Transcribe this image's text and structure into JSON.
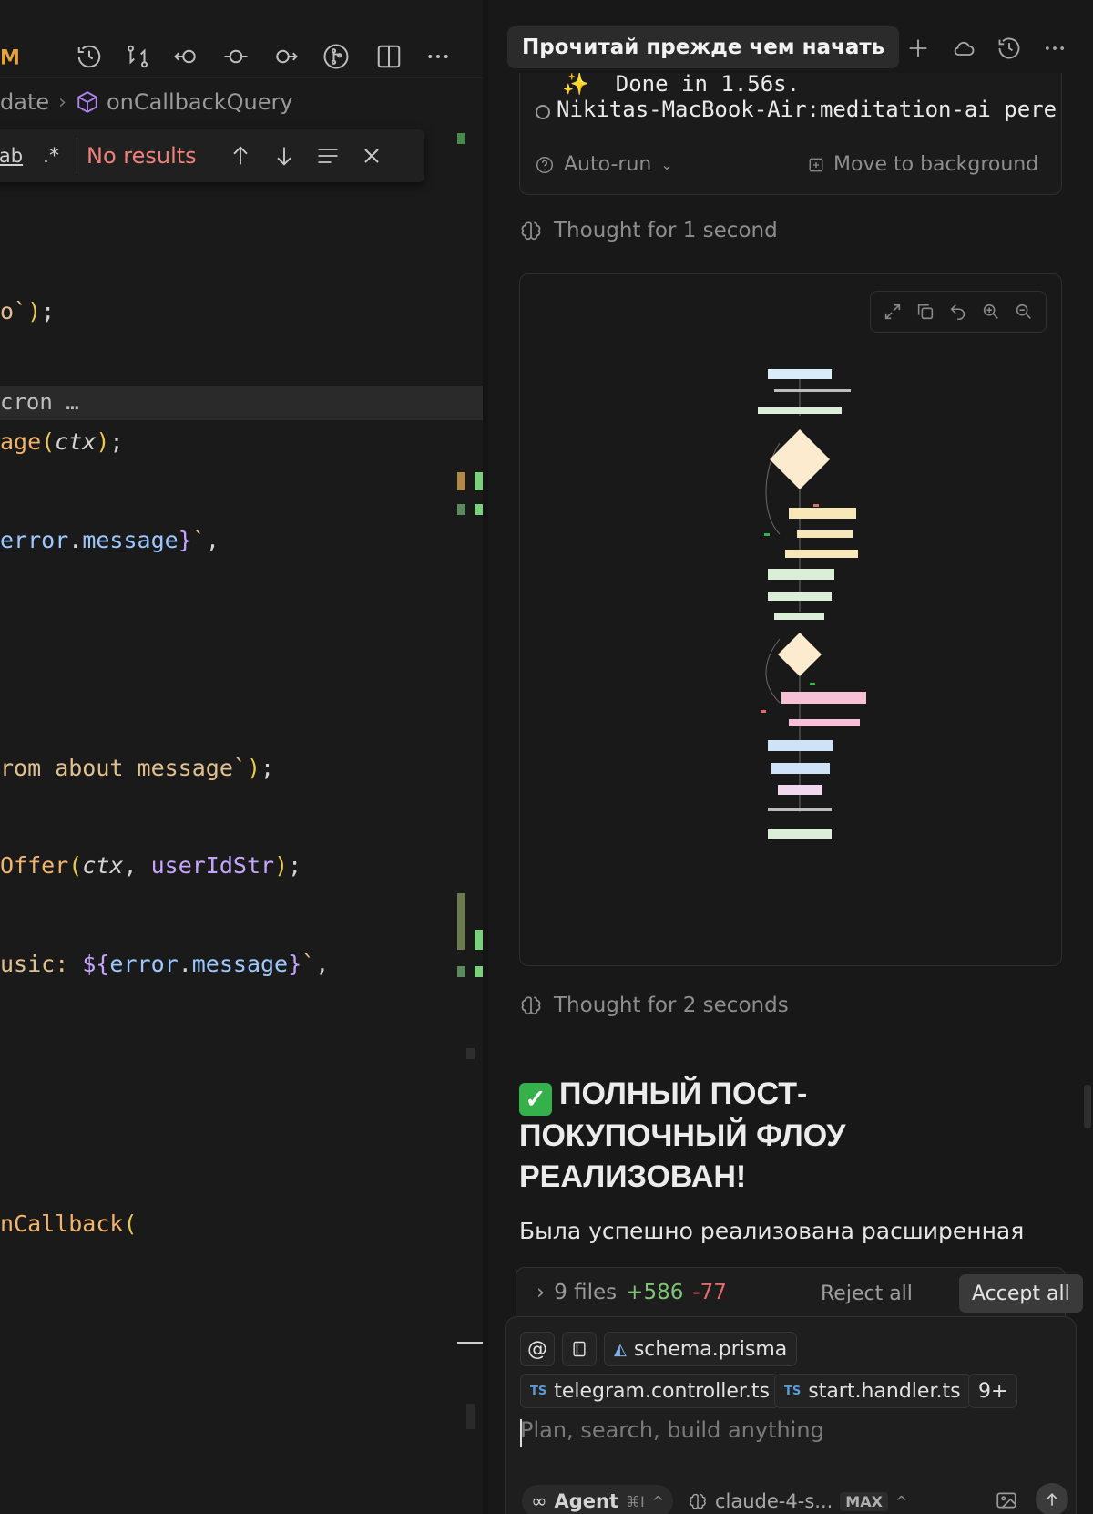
{
  "editor": {
    "brand": "M",
    "breadcrumb": {
      "prev": "date",
      "current": "onCallbackQuery"
    },
    "find": {
      "opt_word": "ab",
      "opt_regex": ".*",
      "status": "No results"
    },
    "folded": "cron …",
    "code": [
      {
        "parts": [
          [
            "c-str",
            "o`"
          ],
          [
            "c-paren",
            ")"
          ],
          [
            "c-punc",
            ";"
          ]
        ]
      },
      {
        "parts": [
          [
            "c-fn",
            "age"
          ],
          [
            "c-paren",
            "("
          ],
          [
            "c-param",
            "ctx"
          ],
          [
            "c-paren",
            ")"
          ],
          [
            "c-punc",
            ";"
          ]
        ]
      },
      {
        "parts": [
          [
            "c-prop",
            "error"
          ],
          [
            "c-punc",
            "."
          ],
          [
            "c-prop",
            "message"
          ],
          [
            "c-brace",
            "}"
          ],
          [
            "c-str",
            "`"
          ],
          [
            "c-punc",
            ","
          ]
        ]
      },
      {
        "parts": [
          [
            "c-str",
            "rom about message`"
          ],
          [
            "c-paren",
            ")"
          ],
          [
            "c-punc",
            ";"
          ]
        ]
      },
      {
        "parts": [
          [
            "c-fn",
            "Offer"
          ],
          [
            "c-paren",
            "("
          ],
          [
            "c-param",
            "ctx"
          ],
          [
            "c-punc",
            ", "
          ],
          [
            "c-var",
            "userIdStr"
          ],
          [
            "c-paren",
            ")"
          ],
          [
            "c-punc",
            ";"
          ]
        ]
      },
      {
        "parts": [
          [
            "c-str",
            "usic: "
          ],
          [
            "c-brace",
            "${"
          ],
          [
            "c-prop",
            "error"
          ],
          [
            "c-punc",
            "."
          ],
          [
            "c-prop",
            "message"
          ],
          [
            "c-brace",
            "}"
          ],
          [
            "c-str",
            "`"
          ],
          [
            "c-punc",
            ","
          ]
        ]
      },
      {
        "parts": [
          [
            "c-fn",
            "nCallback"
          ],
          [
            "c-paren",
            "("
          ]
        ]
      }
    ]
  },
  "chat": {
    "tab_title": "Прочитай прежде чем начать",
    "terminal": {
      "line1": "✨  Done in 1.56s.",
      "line2": "Nikitas-MacBook-Air:meditation-ai pere",
      "auto_run": "Auto-run",
      "background": "Move to background"
    },
    "thought1": "Thought for 1 second",
    "thought2": "Thought for 2 seconds",
    "result_title": "ПОЛНЫЙ ПОСТ-ПОКУПОЧНЫЙ ФЛОУ РЕАЛИЗОВАН!",
    "result_check": "✓",
    "result_text": "Была успешно реализована расширенная",
    "result_text_2": "",
    "changes": {
      "files": "9 files",
      "added": "+586",
      "removed": "-77",
      "reject": "Reject all",
      "accept": "Accept all"
    },
    "composer": {
      "at": "@",
      "chip_prisma": "schema.prisma",
      "chip_tg": "telegram.controller.ts",
      "chip_start": "start.handler.ts",
      "chip_more": "9+",
      "ts": "TS",
      "placeholder": "Plan, search, build anything",
      "agent": "Agent",
      "agent_shortcut": "⌘I",
      "model": "claude-4-s...",
      "max": "MAX"
    }
  },
  "colors": {
    "accent_green": "#35b04a",
    "added": "#7fc474",
    "removed": "#e06c6c",
    "find_error": "#f0807a"
  }
}
